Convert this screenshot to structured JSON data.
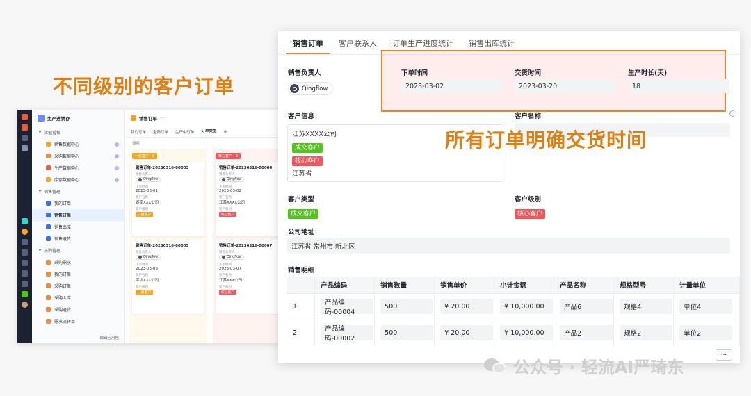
{
  "headline": "不同级别的客户订单",
  "annotation": "所有订单明确交货时间",
  "watermark": "公众号 · 轻流AI严琦东",
  "mini": {
    "app_title": "生产进销存",
    "groups": [
      {
        "label": "数据看板",
        "items": [
          "销售数据中心",
          "采购数据中心",
          "生产数据中心",
          "库存数据中心"
        ]
      },
      {
        "label": "销售管理",
        "items": [
          "我的订单",
          "销售订单",
          "销售出库",
          "销售退货"
        ]
      },
      {
        "label": "采购管理",
        "items": [
          "采购需求",
          "我的订单",
          "采购订单",
          "采购入库",
          "采购退货",
          "需求流转单"
        ]
      }
    ],
    "footer": "编辑应用包",
    "main_title": "销售订单",
    "tabs": [
      "我的订单",
      "全部订单",
      "生产中订单",
      "订单类型"
    ],
    "search": "搜索",
    "columns": [
      {
        "tag": "一般客户 · 2",
        "tag_color": "#f5a623",
        "cards": [
          {
            "title": "销售订单-20230316-00003",
            "l1": "销售负责人",
            "owner": "Qingflow",
            "l2": "下单时间",
            "date": "2023-03-01",
            "l3": "客户名称",
            "customer": "湖南XXX公司",
            "l4": "客户级别",
            "level": "一般客户"
          },
          {
            "title": "销售订单-20230316-00005",
            "l1": "销售负责人",
            "owner": "Qingflow",
            "l2": "下单时间",
            "date": "2023-03-03",
            "l3": "客户名称",
            "customer": "深圳XXX公司",
            "l4": "客户级别",
            "level": "一般客户"
          }
        ]
      },
      {
        "tag": "核心客户 · 2",
        "tag_color": "#f5555a",
        "cards": [
          {
            "title": "销售订单-20230316-00004",
            "l1": "销售负责人",
            "owner": "Qingflow",
            "l2": "下单时间",
            "date": "2023-03-02",
            "l3": "客户名称",
            "customer": "江苏XXXX公司",
            "l4": "客户级别",
            "level": "核心客户"
          },
          {
            "title": "销售订单-20230316-00007",
            "l1": "销售负责人",
            "owner": "Qingflow",
            "l2": "下单时间",
            "date": "2023-03-07",
            "l3": "客户名称",
            "customer": "江苏XXX公司",
            "l4": "客户级别",
            "level": "核心客户"
          }
        ]
      }
    ]
  },
  "panel": {
    "tabs": [
      "销售订单",
      "客户联系人",
      "订单生产进度统计",
      "销售出库统计"
    ],
    "sales_owner_label": "销售负责人",
    "sales_owner": "Qingflow",
    "order_time_label": "下单时间",
    "order_time": "2023-03-02",
    "delivery_time_label": "交货时间",
    "delivery_time": "2023-03-20",
    "duration_label": "生产时长(天)",
    "duration": "18",
    "customer_info_label": "客户信息",
    "customer_info": {
      "company": "江苏XXXX公司",
      "tag1": "成交客户",
      "tag2": "核心客户",
      "province": "江苏省"
    },
    "customer_name_label": "客户名称",
    "customer_type_label": "客户类型",
    "customer_type": "成交客户",
    "customer_level_label": "客户级别",
    "customer_level": "核心客户",
    "address_label": "公司地址",
    "address": "江苏省 常州市 新北区",
    "detail_label": "销售明细",
    "table": {
      "headers": [
        "",
        "产品编码",
        "销售数量",
        "销售单价",
        "小计金额",
        "产品名称",
        "规格型号",
        "计量单位"
      ],
      "rows": [
        [
          "1",
          "产品编码-00004",
          "500",
          "¥ 20.00",
          "¥ 10,000.00",
          "产品6",
          "规格4",
          "单位4"
        ],
        [
          "2",
          "产品编码-00002",
          "500",
          "¥ 20.00",
          "¥ 10,000.00",
          "产品2",
          "规格2",
          "单位2"
        ]
      ]
    },
    "more": "..."
  },
  "colors": {
    "accent": "#e07f0f",
    "tab_underline": "#e8852d",
    "tag_green": "#52c41a",
    "tag_red": "#f5555a",
    "tag_orange": "#f5a623"
  }
}
